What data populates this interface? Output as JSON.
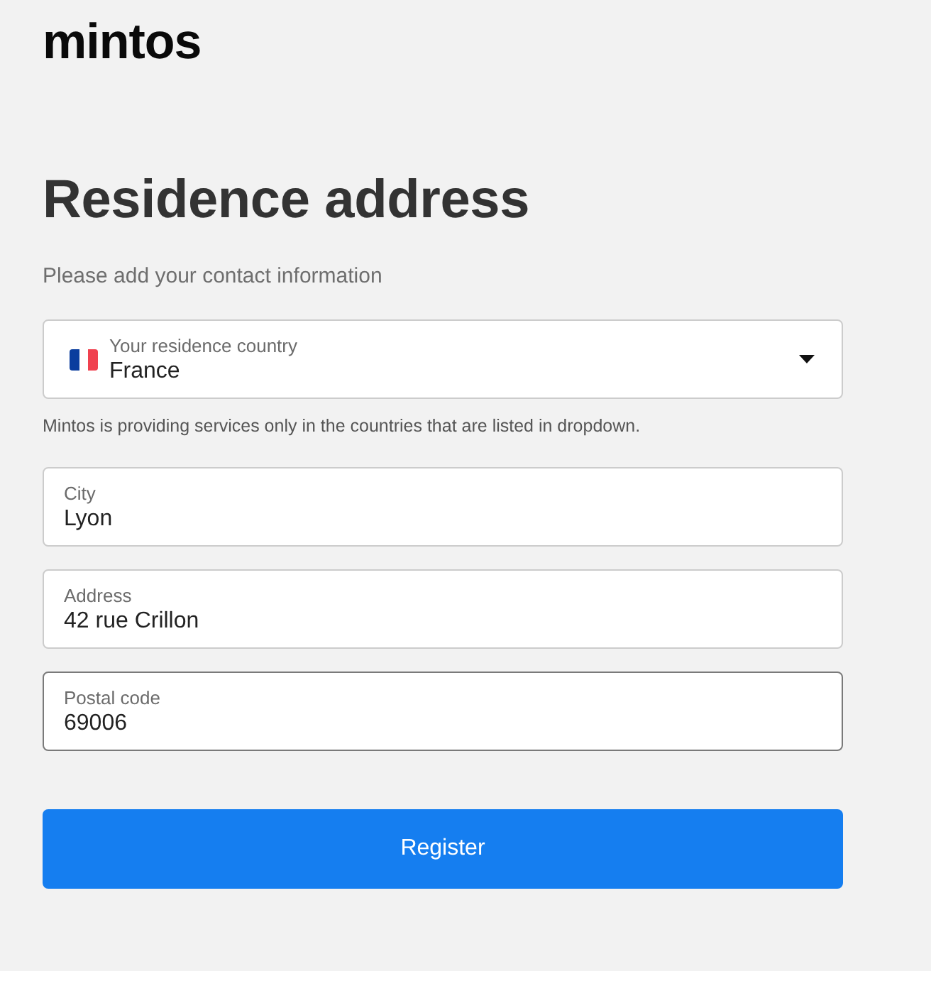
{
  "logo": {
    "text": "mintos"
  },
  "heading": "Residence address",
  "subtitle": "Please add your contact information",
  "country_select": {
    "label": "Your residence country",
    "value": "France",
    "focused": false
  },
  "country_hint": "Mintos is providing services only in the countries that are listed in dropdown.",
  "fields": [
    {
      "label": "City",
      "value": "Lyon",
      "focused": false
    },
    {
      "label": "Address",
      "value": "42 rue Crillon",
      "focused": false
    },
    {
      "label": "Postal code",
      "value": "69006",
      "focused": true
    }
  ],
  "button": {
    "label": "Register"
  }
}
